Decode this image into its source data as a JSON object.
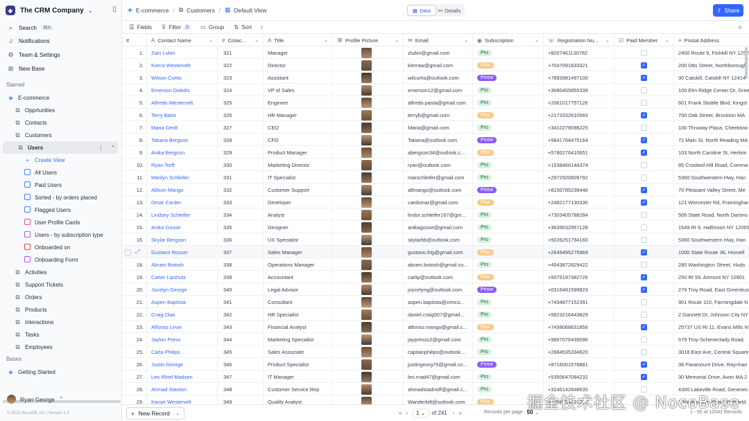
{
  "workspace": {
    "name": "The CRM Company"
  },
  "nav": {
    "search": "Search",
    "search_kbd": "⌘K",
    "notifications": "Notifications",
    "team": "Team & Settings",
    "new_base": "New Base"
  },
  "sidebar": {
    "starred_label": "Starred",
    "base_name": "E-commerce",
    "tables": [
      "Opprtunities",
      "Contacts",
      "Customers"
    ],
    "users_table": "Users",
    "views": [
      {
        "label": "Create View",
        "icon": "plus-icon",
        "color": "#3366ff"
      },
      {
        "label": "All Users",
        "icon": "grid-view-icon",
        "color": "#3b82f6"
      },
      {
        "label": "Paid Users",
        "icon": "grid-view-icon",
        "color": "#3b82f6"
      },
      {
        "label": "Sorted - by orders placed",
        "icon": "grid-view-icon",
        "color": "#3b82f6"
      },
      {
        "label": "Flagged Users",
        "icon": "grid-view-icon",
        "color": "#3b82f6"
      },
      {
        "label": "User Profile Cards",
        "icon": "gallery-view-icon",
        "color": "#ec4899"
      },
      {
        "label": "Users - by subscription type",
        "icon": "kanban-view-icon",
        "color": "#a855f7"
      },
      {
        "label": "Onboarded on",
        "icon": "calendar-view-icon",
        "color": "#ef4444"
      },
      {
        "label": "Onboarding Form",
        "icon": "form-view-icon",
        "color": "#a855f7"
      }
    ],
    "more_tables": [
      "Activities",
      "Support Tickets",
      "Orders",
      "Products",
      "Interactions",
      "Tasks",
      "Employees"
    ],
    "bases_label": "Bases",
    "getting_started": "Getting Started",
    "user_name": "Ryan George",
    "footer": "© 2023 NocoDB, Inc | Version 2.3"
  },
  "topbar": {
    "crumbs": [
      "E-commerce",
      "Customers",
      "Default View"
    ],
    "data_tab": "Data",
    "details_tab": "Details",
    "share": "Share"
  },
  "toolbar": {
    "fields": "Fields",
    "filter": "Filter",
    "filter_count": "2",
    "group": "Group",
    "sort": "Sort"
  },
  "columns": [
    {
      "label": "#",
      "icon": ""
    },
    {
      "label": "Contact Name",
      "icon": "text-field-icon"
    },
    {
      "label": "Cotac...",
      "icon": "number-field-icon"
    },
    {
      "label": "Title",
      "icon": "text-field-icon"
    },
    {
      "label": "Profile Picture",
      "icon": "attachment-field-icon"
    },
    {
      "label": "Email",
      "icon": "email-field-icon"
    },
    {
      "label": "Subscription",
      "icon": "select-field-icon"
    },
    {
      "label": "Registration Nu...",
      "icon": "phone-field-icon"
    },
    {
      "label": "Paid Member",
      "icon": "checkbox-field-icon"
    },
    {
      "label": "Postal Address",
      "icon": "longtext-field-icon"
    }
  ],
  "rows": [
    [
      "1.",
      "Zain Lubin",
      "321",
      "Manager",
      "zlubin@gmail.com",
      "Pro",
      "+8207461130782",
      "false",
      "2400 Route 9, Fishkill NY 1252"
    ],
    [
      "2.",
      "Kierra Westervelt",
      "322",
      "Director",
      "kierraw@gmail.com",
      "Plus",
      "+7047091633321",
      "true",
      "200 Otis Street, Northborough"
    ],
    [
      "3.",
      "Wilson Curtis",
      "323",
      "Assistant",
      "wilcurtis@outlook.com",
      "Prime",
      "+7893981497100",
      "true",
      "30 Catskill, Catskill NY 12414"
    ],
    [
      "4.",
      "Emerson Dokidis",
      "324",
      "VP of Sales",
      "emerson12@gmail.com",
      "Pro",
      "+3080455855339",
      "false",
      "100 Elm Ridge Center Dr, Gree"
    ],
    [
      "5.",
      "Alfredo Westervelt",
      "325",
      "Engineer",
      "alfredo.pasta@gmail.com",
      "Pro",
      "+2061017757126",
      "false",
      "601 Frank Stottile Blvd, Kingst"
    ],
    [
      "6.",
      "Terry Bator",
      "326",
      "HR Manager",
      "terryb@gmail.com",
      "Plus",
      "+2173332610583",
      "true",
      "700 Oak Street, Brockton MA"
    ],
    [
      "7.",
      "Maria Geidt",
      "327",
      "CEO",
      "Maria@gmail.com",
      "Pro",
      "+3410278098225",
      "false",
      "100 Thruway Plaza, Cheektow"
    ],
    [
      "8.",
      "Tatiana Bergson",
      "328",
      "CFO",
      "Tatiana@outlook.com",
      "Prime",
      "+5641764475164",
      "true",
      "72 Main St, North Reading MA"
    ],
    [
      "9.",
      "Anika Bergson",
      "329",
      "Product Manager",
      "abergson34@outlook.c...",
      "Plus",
      "+5780276410651",
      "true",
      "103 North Caroline St, Herkim"
    ],
    [
      "10.",
      "Ryan Torff",
      "330",
      "Marketing Director",
      "ryan@outlook.com",
      "Pro",
      "+1538466144374",
      "false",
      "85 Crooked Hill Road, Comma"
    ],
    [
      "11.",
      "Marilyn Schleifer",
      "331",
      "IT Specialist",
      "marschleifer@gmail.com",
      "Pro",
      "+2972920609792",
      "false",
      "5360 Southwestern Hwy, Han"
    ],
    [
      "12.",
      "Allison Mango",
      "332",
      "Customer Support",
      "allmango@outlook.com",
      "Prime",
      "+8150785239446",
      "true",
      "70 Pleasant Valley Street, Me"
    ],
    [
      "13.",
      "Omar Carder",
      "333",
      "Developer",
      "cardomar@gmail.com",
      "Plus",
      "+2482177130336",
      "true",
      "121 Worcester Rd, Framinghar"
    ],
    [
      "14.",
      "Lindsey Schleifer",
      "334",
      "Analyst",
      "lindor.schleifer167@gm...",
      "Pro",
      "+7303405788284",
      "false",
      "506 State Road, North Dartmo"
    ],
    [
      "15.",
      "Anika Gouse",
      "335",
      "Designer",
      "anikagoose@gmail.com",
      "Pro",
      "+3639032957128",
      "false",
      "1549 Rt 9, Halfmoon NY 12065"
    ],
    [
      "16.",
      "Skylar Bergson",
      "336",
      "UX Specialist",
      "skylarbb@outlook.com",
      "Pro",
      "+5026251794160",
      "false",
      "5360 Southwestern Hwy, Han"
    ],
    [
      "17.",
      "Gustavo Rosser",
      "337",
      "Sales Manager",
      "gustavo.frig@gmail.com",
      "Plus",
      "+2649495275969",
      "true",
      "1000 State Route 36, Hornell"
    ],
    [
      "18.",
      "Abram Botosh",
      "338",
      "Operations Manager",
      "abram.botosh@gmail.co...",
      "Pro",
      "+4543872829422",
      "false",
      "280 Washington Street, Huds"
    ],
    [
      "19.",
      "Carter Lipshutz",
      "339",
      "Accountant",
      "carlip@outlook.com",
      "Plus",
      "+9375197382726",
      "true",
      "250 Rt 59, Airmont NY 10901"
    ],
    [
      "20.",
      "Jocelyn George",
      "340",
      "Legal Advisor",
      "joycelyng@outlook.com",
      "Prime",
      "+0316481599823",
      "true",
      "279 Troy Road, East Greenbus"
    ],
    [
      "21.",
      "Aspen Baptista",
      "341",
      "Consultant",
      "aspen.baptista@crmco...",
      "Pro",
      "+7434877152391",
      "false",
      "901 Route 110, Farmingdale N"
    ],
    [
      "22.",
      "Craig Dias",
      "342",
      "HR Specialist",
      "daniel.craig007@gmail...",
      "Pro",
      "+5823216443829",
      "false",
      "2 Gannett Dr, Johnson City NY"
    ],
    [
      "23.",
      "Alfonso Levin",
      "343",
      "Financial Analyst",
      "alfonso.mango@gmail.c...",
      "Plus",
      "+7439068631856",
      "true",
      "25737 US Rt 11, Evans Mills NY"
    ],
    [
      "24.",
      "Jaylon Press",
      "344",
      "Marketing Specialist",
      "jaypresss2@gmail.com",
      "Pro",
      "+9897076439096",
      "false",
      "579 Troy-Schenectady Road,"
    ],
    [
      "25.",
      "Carla Philips",
      "345",
      "Sales Associate",
      "captainphilips@outlook...",
      "Pro",
      "+2684535334620",
      "false",
      "3018 East Ave, Central Square"
    ],
    [
      "26.",
      "Justin George",
      "346",
      "Product Specialist",
      "justingeorg76@gmail.co...",
      "Prime",
      "+8716001578881",
      "true",
      "36 Paramount Drive, Raynhan"
    ],
    [
      "27.",
      "Leo Rhiel Madsen",
      "347",
      "IT Manager",
      "leo.mad47@gmail.com",
      "Pro",
      "+5350647084232",
      "true",
      "30 Memorial Drive, Avon MA 2"
    ],
    [
      "28.",
      "Ahmad Stanton",
      "348",
      "Customer Service Rep",
      "ahmadstadnoff@gmail.c...",
      "Pro",
      "+3245142848635",
      "false",
      "4300 Lakeville Road, Genesec"
    ],
    [
      "29.",
      "Kanye Westervelt",
      "349",
      "Quality Analyst",
      "Wanderbilt@outlook.com",
      "Plus",
      "+1258734901247",
      "false",
      "3 Reservation Road, Pittsfield"
    ]
  ],
  "footer": {
    "new_record": "New Record",
    "page": "1",
    "of_pages": "of 241",
    "rows_per_page_label": "Records per page",
    "rows_per_page": "50",
    "record_count": "1 - 50 of 12042 Records"
  },
  "watermark": "掘金技术社区 @ NocoBase"
}
